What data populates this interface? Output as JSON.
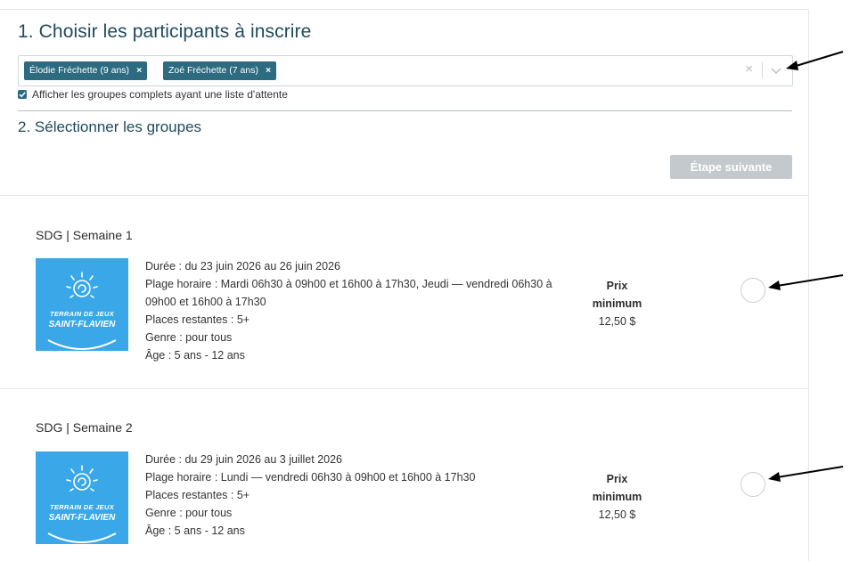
{
  "step1": {
    "title": "1. Choisir les participants à inscrire",
    "participants": [
      {
        "label": "Élodie Fréchette (9 ans)",
        "remove": "×"
      },
      {
        "label": "Zoé Fréchette (7 ans)",
        "remove": "×"
      }
    ],
    "clear_icon": "×",
    "checkbox_label": "Afficher les groupes complets ayant une liste d'attente",
    "checkbox_checked": true
  },
  "step2": {
    "title": "2. Sélectionner les groupes",
    "next_button": "Étape suivante"
  },
  "groups": [
    {
      "title": "SDG | Semaine 1",
      "logo": {
        "line1": "TERRAIN DE JEUX",
        "line2": "SAINT-FLAVIEN"
      },
      "duration": "Durée : du 23 juin 2026 au 26 juin 2026",
      "schedule": "Plage horaire : Mardi 06h30 à 09h00 et 16h00 à 17h30, Jeudi — vendredi 06h30 à 09h00 et 16h00 à 17h30",
      "places": "Places restantes : 5+",
      "gender": "Genre : pour tous",
      "age": "Âge : 5 ans - 12 ans",
      "price_label_1": "Prix",
      "price_label_2": "minimum",
      "price_value": "12,50 $"
    },
    {
      "title": "SDG | Semaine 2",
      "logo": {
        "line1": "TERRAIN DE JEUX",
        "line2": "SAINT-FLAVIEN"
      },
      "duration": "Durée : du 29 juin 2026 au 3 juillet 2026",
      "schedule": "Plage horaire : Lundi — vendredi 06h30 à 09h00 et 16h00 à 17h30",
      "places": "Places restantes : 5+",
      "gender": "Genre : pour tous",
      "age": "Âge : 5 ans - 12 ans",
      "price_label_1": "Prix",
      "price_label_2": "minimum",
      "price_value": "12,50 $"
    }
  ],
  "colors": {
    "accent": "#2c6b80",
    "heading": "#1f4a5e",
    "logo_bg": "#3aa8e8",
    "disabled_button": "#c3c9cd"
  },
  "icons": [
    "close-icon",
    "chevron-down-icon",
    "checkbox-checked-icon",
    "sun-spiral-logo",
    "arrow-annotation-icon"
  ]
}
